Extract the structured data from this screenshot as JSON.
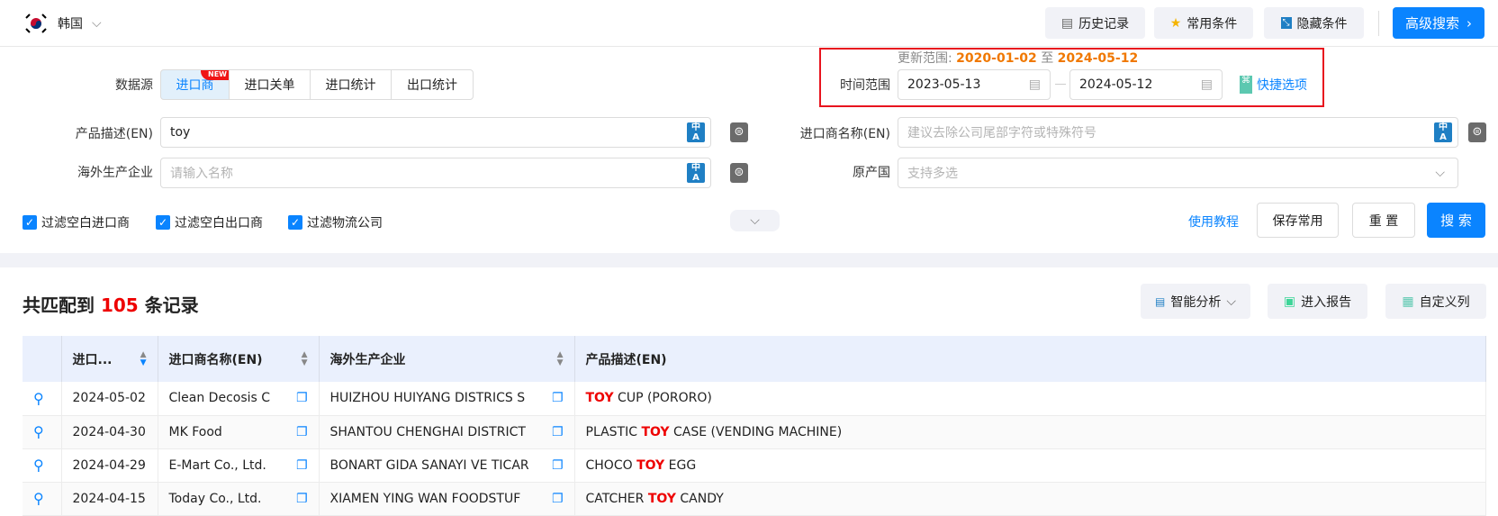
{
  "topbar": {
    "country": "韩国",
    "buttons": {
      "history": "历史记录",
      "favorites": "常用条件",
      "hide": "隐藏条件",
      "advanced": "高级搜索"
    }
  },
  "update_range": {
    "label": "更新范围:",
    "start": "2020-01-02",
    "sep": "至",
    "end": "2024-05-12"
  },
  "time_range": {
    "label": "时间范围",
    "start": "2023-05-13",
    "end": "2024-05-12",
    "quick": "快捷选项"
  },
  "datasource": {
    "label": "数据源",
    "tabs": [
      {
        "label": "进口商",
        "active": true,
        "badge": "NEW"
      },
      {
        "label": "进口关单"
      },
      {
        "label": "进口统计"
      },
      {
        "label": "出口统计"
      }
    ]
  },
  "fields": {
    "product_desc": {
      "label": "产品描述(EN)",
      "value": "toy"
    },
    "overseas": {
      "label": "海外生产企业",
      "placeholder": "请输入名称"
    },
    "importer": {
      "label": "进口商名称(EN)",
      "placeholder": "建议去除公司尾部字符或特殊符号"
    },
    "origin": {
      "label": "原产国",
      "placeholder": "支持多选"
    }
  },
  "filters": [
    {
      "label": "过滤空白进口商",
      "checked": true
    },
    {
      "label": "过滤空白出口商",
      "checked": true
    },
    {
      "label": "过滤物流公司",
      "checked": true
    }
  ],
  "actions": {
    "tutorial": "使用教程",
    "save": "保存常用",
    "reset": "重 置",
    "search": "搜 索"
  },
  "results": {
    "prefix": "共匹配到",
    "count": "105",
    "suffix": "条记录",
    "buttons": {
      "analysis": "智能分析",
      "report": "进入报告",
      "columns": "自定义列"
    }
  },
  "table": {
    "headers": [
      "进口...",
      "进口商名称(EN)",
      "海外生产企业",
      "产品描述(EN)"
    ],
    "rows": [
      {
        "date": "2024-05-02",
        "importer": "Clean Decosis C",
        "overseas": "HUIZHOU HUIYANG DISTRICS S",
        "desc": [
          "",
          "TOY",
          " CUP (PORORO)"
        ]
      },
      {
        "date": "2024-04-30",
        "importer": "MK Food",
        "overseas": "SHANTOU CHENGHAI DISTRICT",
        "desc": [
          "PLASTIC ",
          "TOY",
          " CASE (VENDING MACHINE)"
        ]
      },
      {
        "date": "2024-04-29",
        "importer": "E-Mart Co., Ltd.",
        "overseas": "BONART GIDA SANAYI VE TICAR",
        "desc": [
          "CHOCO ",
          "TOY",
          " EGG"
        ]
      },
      {
        "date": "2024-04-15",
        "importer": "Today Co., Ltd.",
        "overseas": "XIAMEN YING WAN FOODSTUF",
        "desc": [
          "CATCHER ",
          "TOY",
          " CANDY"
        ]
      }
    ]
  },
  "colors": {
    "primary": "#0a84ff",
    "highlight": "#e00000",
    "orange": "#f07800"
  }
}
